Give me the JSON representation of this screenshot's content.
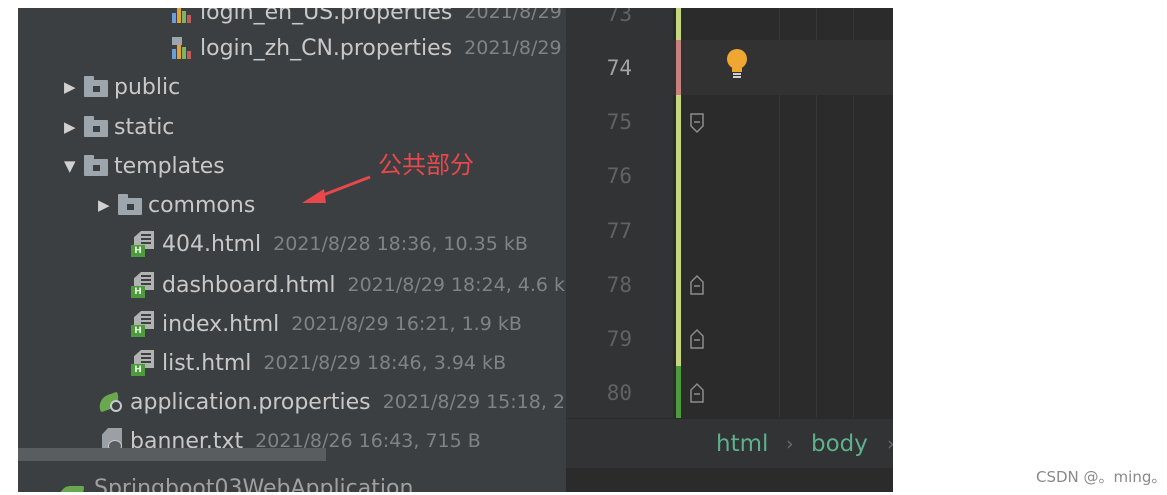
{
  "tree": {
    "partial_top": {
      "name": "login_en_US.properties",
      "meta": "2021/8/29"
    },
    "items": [
      {
        "name": "login_zh_CN.properties",
        "meta": "2021/8/29"
      },
      {
        "name": "public",
        "arrow": "▶"
      },
      {
        "name": "static",
        "arrow": "▶"
      },
      {
        "name": "templates",
        "arrow": "▼"
      },
      {
        "name": "commons",
        "arrow": "▶"
      },
      {
        "name": "404.html",
        "meta": "2021/8/28 18:36, 10.35 kB"
      },
      {
        "name": "dashboard.html",
        "meta": "2021/8/29 18:24, 4.6 k"
      },
      {
        "name": "index.html",
        "meta": "2021/8/29 16:21, 1.9 kB"
      },
      {
        "name": "list.html",
        "meta": "2021/8/29 18:46, 3.94 kB"
      },
      {
        "name": "application.properties",
        "meta": "2021/8/29 15:18, 2"
      },
      {
        "name": "banner.txt",
        "meta": "2021/8/26 16:43, 715 B"
      }
    ],
    "bottom_partial": "Springboot03WebApplication"
  },
  "gutter": {
    "line_numbers": [
      "73",
      "74",
      "75",
      "76",
      "77",
      "78",
      "79",
      "80"
    ],
    "current_line": "74"
  },
  "breadcrumb": {
    "items": [
      "html",
      "body"
    ],
    "separator": "›"
  },
  "annotation": {
    "text": "公共部分",
    "color": "#e8474b"
  },
  "watermark": "CSDN @。ming。",
  "colors": {
    "ide_bg": "#3c3f41",
    "editor_bg": "#2b2b2b",
    "breadcrumb_text": "#5fb08c",
    "html_icon_green": "#4e9a3f"
  }
}
